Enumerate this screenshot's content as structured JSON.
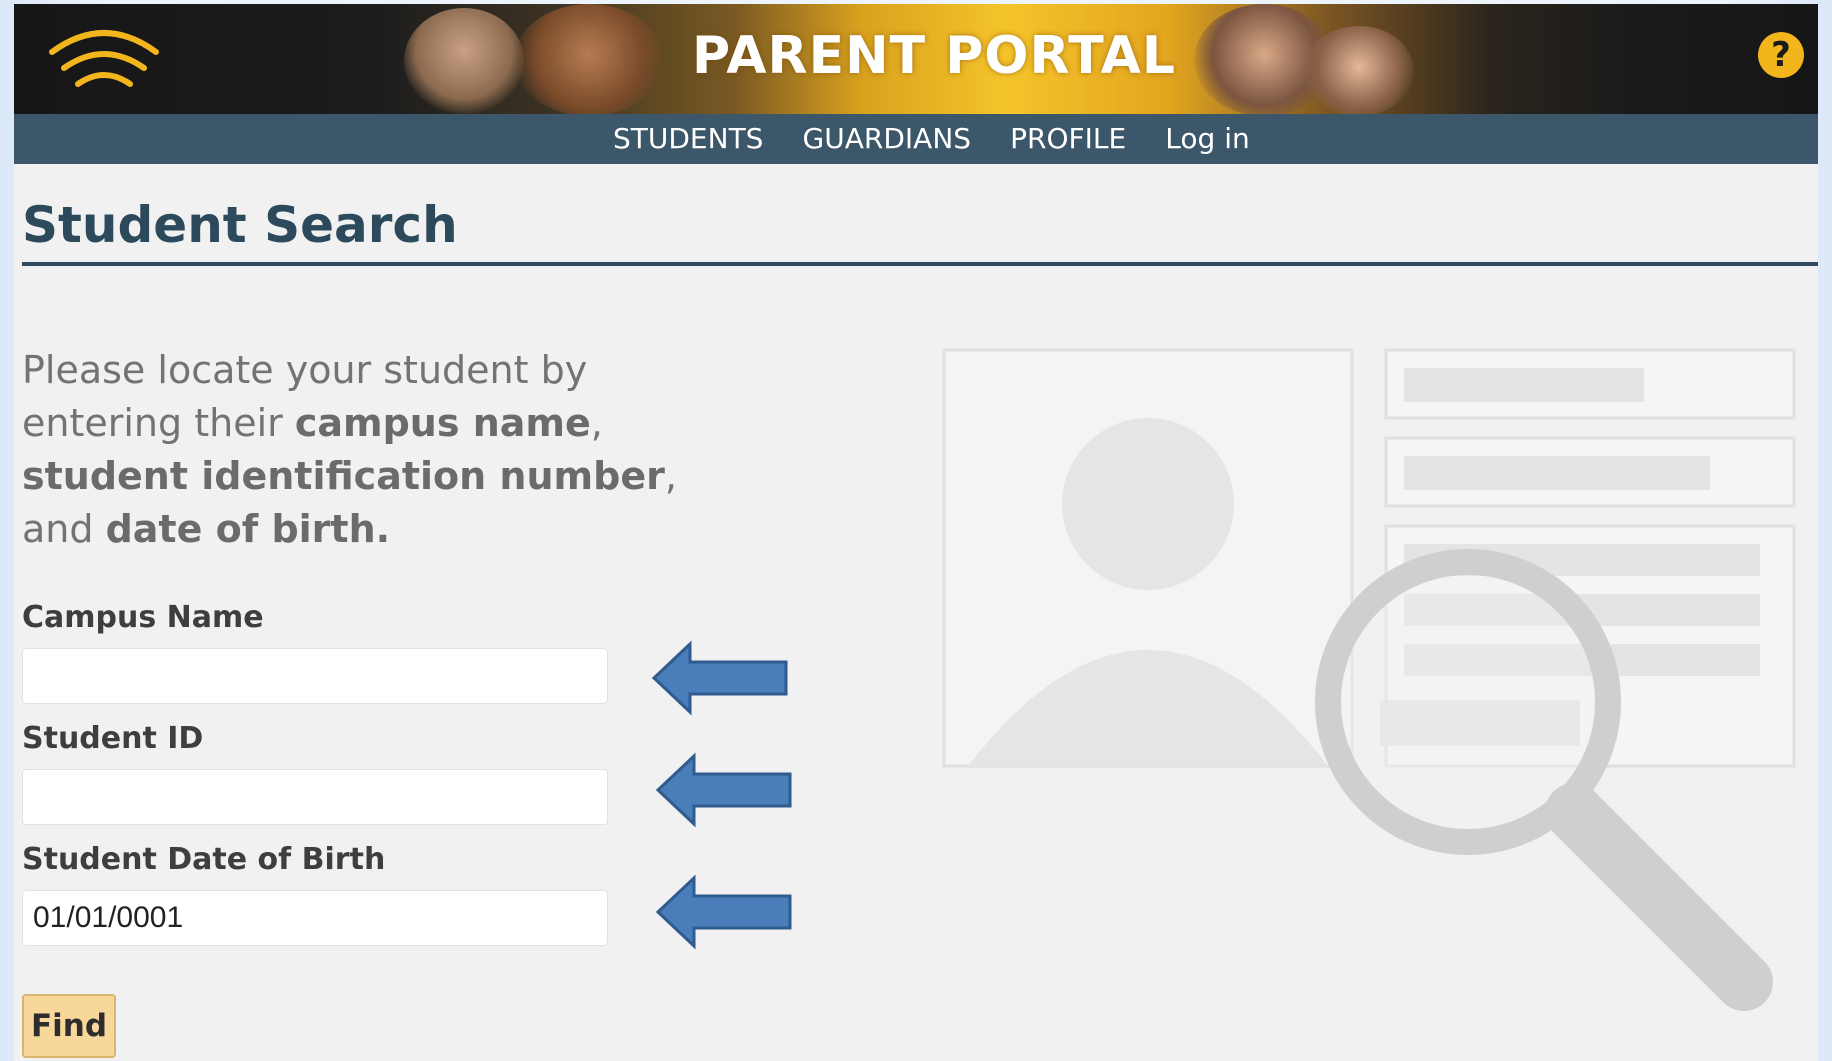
{
  "header": {
    "title": "PARENT PORTAL",
    "help_icon_label": "?",
    "logo_icon": "wifi-signal-icon"
  },
  "nav": {
    "items": [
      {
        "label": "STUDENTS"
      },
      {
        "label": "GUARDIANS"
      },
      {
        "label": "PROFILE"
      },
      {
        "label": "Log in"
      }
    ]
  },
  "page": {
    "title": "Student Search",
    "intro": {
      "part1": "Please locate your student by entering their ",
      "bold1": "campus name",
      "part2": ", ",
      "bold2": "student identification number",
      "part3": ", and ",
      "bold3": "date of birth."
    }
  },
  "form": {
    "campus_name": {
      "label": "Campus Name",
      "value": ""
    },
    "student_id": {
      "label": "Student ID",
      "value": ""
    },
    "date_of_birth": {
      "label": "Student Date of Birth",
      "value": "01/01/0001"
    },
    "find_label": "Find"
  },
  "colors": {
    "nav_bg": "#3c566a",
    "heading": "#2d4a5d",
    "help_icon": "#f3b51c",
    "find_button": "#f8d89a",
    "arrow": "#4a7ebb"
  },
  "icons": {
    "arrow": "left-arrow-icon",
    "illustration": "student-search-placeholder-icon"
  }
}
